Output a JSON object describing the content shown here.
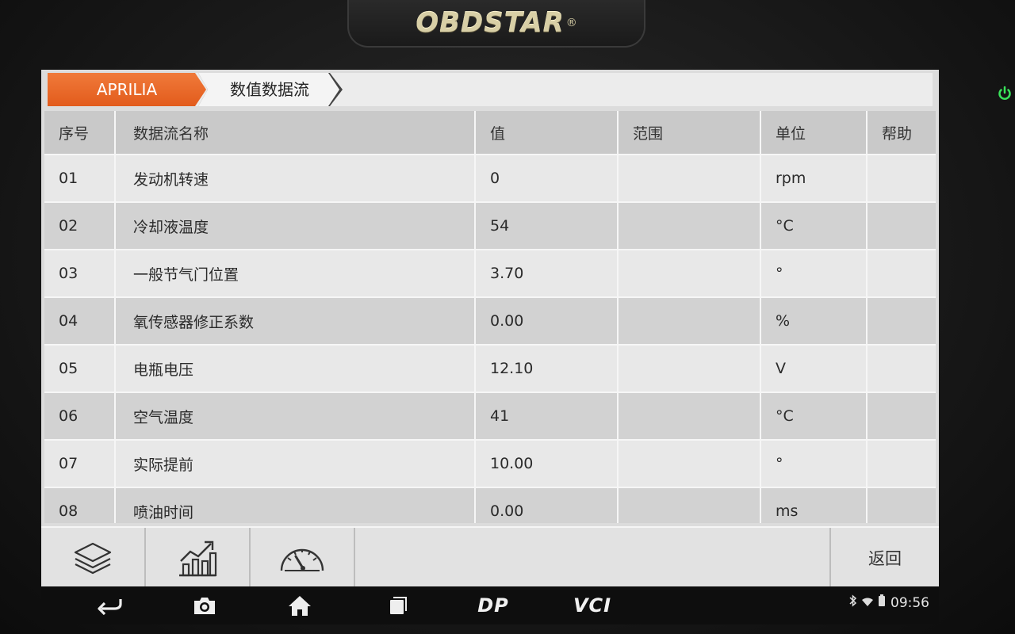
{
  "device": {
    "brand_logo": "OBDSTAR",
    "registered_mark": "®",
    "power_icon": "power-icon"
  },
  "breadcrumb": {
    "brand": "APRILIA",
    "page": "数值数据流"
  },
  "table": {
    "columns": [
      "序号",
      "数据流名称",
      "值",
      "范围",
      "单位",
      "帮助"
    ],
    "rows": [
      {
        "no": "01",
        "name": "发动机转速",
        "value": "0",
        "range": "",
        "unit": "rpm",
        "help": ""
      },
      {
        "no": "02",
        "name": "冷却液温度",
        "value": "54",
        "range": "",
        "unit": "°C",
        "help": ""
      },
      {
        "no": "03",
        "name": "一般节气门位置",
        "value": "3.70",
        "range": "",
        "unit": "°",
        "help": ""
      },
      {
        "no": "04",
        "name": "氧传感器修正系数",
        "value": "0.00",
        "range": "",
        "unit": "%",
        "help": ""
      },
      {
        "no": "05",
        "name": "电瓶电压",
        "value": "12.10",
        "range": "",
        "unit": "V",
        "help": ""
      },
      {
        "no": "06",
        "name": "空气温度",
        "value": "41",
        "range": "",
        "unit": "°C",
        "help": ""
      },
      {
        "no": "07",
        "name": "实际提前",
        "value": "10.00",
        "range": "",
        "unit": "°",
        "help": ""
      },
      {
        "no": "08",
        "name": "喷油时间",
        "value": "0.00",
        "range": "",
        "unit": "ms",
        "help": ""
      }
    ]
  },
  "toolbar": {
    "tools": [
      "layers-icon",
      "line-chart-icon",
      "gauge-icon"
    ],
    "back_label": "返回"
  },
  "navbar": {
    "buttons": [
      "back-icon",
      "camera-icon",
      "home-icon",
      "recents-icon"
    ],
    "dp_label": "DP",
    "vci_label": "VCI",
    "time": "09:56",
    "status_icons": [
      "bluetooth-icon",
      "wifi-icon",
      "battery-icon"
    ]
  },
  "colors": {
    "brand_tab": "#e9671f",
    "header_bg": "#c9c9c9",
    "row_light": "#e8e8e8",
    "row_dark": "#d2d2d2",
    "power_led": "#39e35a"
  }
}
